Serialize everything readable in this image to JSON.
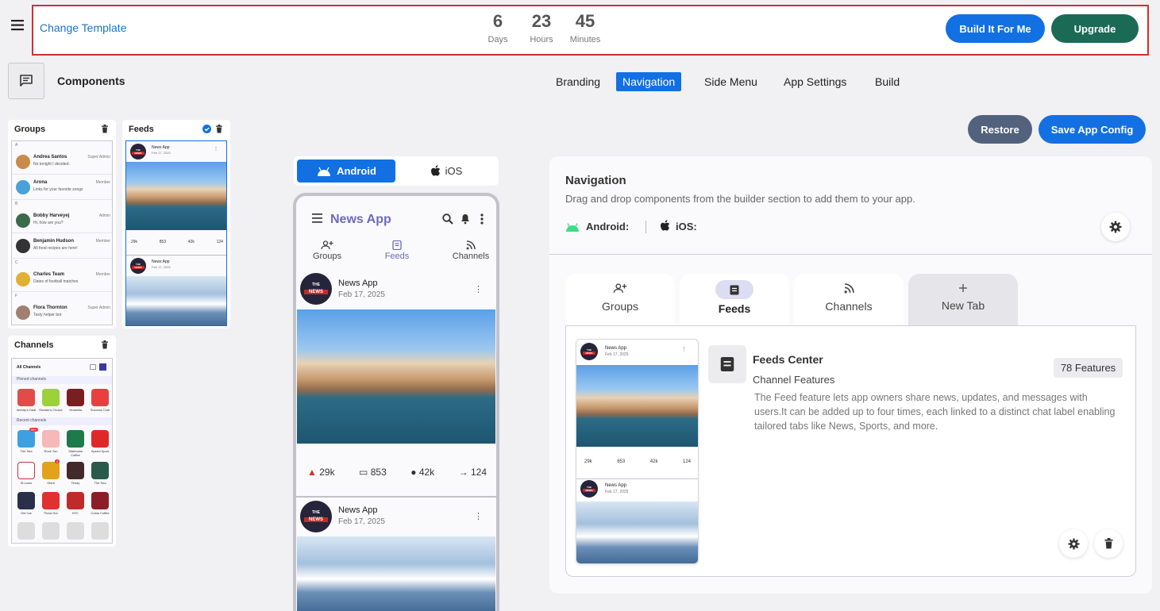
{
  "topbar": {
    "change_template": "Change Template",
    "countdown": [
      {
        "value": "6",
        "unit": "Days"
      },
      {
        "value": "23",
        "unit": "Hours"
      },
      {
        "value": "45",
        "unit": "Minutes"
      }
    ],
    "build_btn": "Build It For Me",
    "upgrade_btn": "Upgrade"
  },
  "components": {
    "title": "Components"
  },
  "nav_tabs": [
    "Branding",
    "Navigation",
    "Side Menu",
    "App Settings",
    "Build"
  ],
  "groups_card": {
    "title": "Groups",
    "rows": [
      {
        "letter": "A",
        "name": "Andrea Santos",
        "msg": "No tonight I decided.",
        "role": "Super Admin"
      },
      {
        "letter": "",
        "name": "Arona",
        "msg": "Links for your favorite songs",
        "role": "Member"
      },
      {
        "letter": "B",
        "name": "Bobby Harveyej",
        "msg": "Hi, how are you?",
        "role": "Admin"
      },
      {
        "letter": "",
        "name": "Benjamin Hudson",
        "msg": "All food recipes are here!",
        "role": "Member"
      },
      {
        "letter": "C",
        "name": "Charles Team",
        "msg": "Dates of football matches",
        "role": "Member"
      },
      {
        "letter": "F",
        "name": "Flora Thornton",
        "msg": "Tasty helper bot",
        "role": "Super Admin"
      }
    ]
  },
  "feeds_card": {
    "title": "Feeds",
    "post_author": "News App",
    "post_date": "Feb 17, 2025",
    "stats": [
      "29k",
      "853",
      "42k",
      "124"
    ]
  },
  "channels_card": {
    "title": "Channels",
    "all_label": "All Channels",
    "pinned_label": "Pinned channels",
    "recent_label": "Recent channels",
    "pinned": [
      {
        "name": "Wendy's Deal",
        "color": "#e34b4b"
      },
      {
        "name": "Reader's Choice",
        "color": "#9bd13b"
      },
      {
        "name": "Vendetta",
        "color": "#7a1f1f"
      },
      {
        "name": "Success Club",
        "color": "#e84040"
      }
    ],
    "recent": [
      {
        "name": "The Sea",
        "color": "#3ea0e0",
        "badge": "99+"
      },
      {
        "name": "Rock You",
        "color": "#f6b8b8"
      },
      {
        "name": "Starbucks Coffee",
        "color": "#1e7a4a"
      },
      {
        "name": "Speed Sport",
        "color": "#e02828"
      },
      {
        "name": "St.Louis",
        "color": "#ffffff"
      },
      {
        "name": "Giant",
        "color": "#e3a21a",
        "badge": "2"
      },
      {
        "name": "Tenay",
        "color": "#402a2a"
      },
      {
        "name": "The Sea",
        "color": "#2a5a4a"
      },
      {
        "name": "Old Car",
        "color": "#2a2f4a"
      },
      {
        "name": "Pizza Hut",
        "color": "#e03030"
      },
      {
        "name": "KFC",
        "color": "#c02a2a"
      },
      {
        "name": "Costa Coffee",
        "color": "#8a1f2a"
      }
    ]
  },
  "phone": {
    "android_label": "Android",
    "ios_label": "iOS",
    "app_title": "News App",
    "tabs": [
      "Groups",
      "Feeds",
      "Channels"
    ],
    "post1": {
      "author": "News App",
      "date": "Feb 17, 2025"
    },
    "post2": {
      "author": "News App",
      "date": "Feb 17, 2025"
    },
    "stats": [
      "29k",
      "853",
      "42k",
      "124"
    ],
    "logo_top": "THE",
    "logo_bottom": "NEWS"
  },
  "actions": {
    "restore": "Restore",
    "save": "Save App Config"
  },
  "navigation_panel": {
    "title": "Navigation",
    "description": "Drag and drop components from the builder section to add them to your app.",
    "android_label": "Android:",
    "ios_label": "iOS:",
    "tabs": [
      "Groups",
      "Feeds",
      "Channels",
      "New Tab"
    ],
    "feature": {
      "title": "Feeds Center",
      "subtitle": "Channel Features",
      "badge": "78 Features",
      "description": "The Feed feature lets app owners share news, updates, and messages with users.It can be added up to four times, each linked to a distinct chat label enabling tailored tabs like News, Sports, and more."
    },
    "preview": {
      "author": "News App",
      "date": "Feb 17, 2025",
      "stats": [
        "29k",
        "853",
        "42k",
        "124"
      ]
    }
  },
  "colors": {
    "primary": "#1270e3",
    "upgrade": "#1b6a55",
    "restore": "#53627c",
    "brand_purple": "#6b6bbd"
  }
}
